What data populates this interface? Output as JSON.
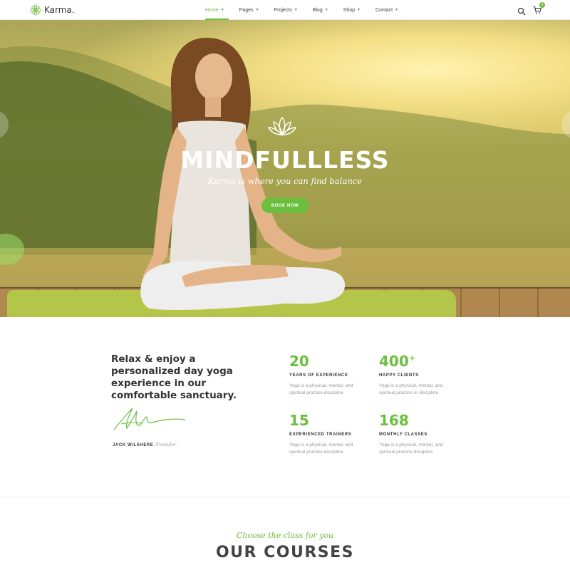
{
  "header": {
    "logo_text": "Karma.",
    "logo_icon": "flower-icon",
    "nav": [
      {
        "label": "Home",
        "active": true
      },
      {
        "label": "Pages",
        "active": false
      },
      {
        "label": "Projects",
        "active": false
      },
      {
        "label": "Blog",
        "active": false
      },
      {
        "label": "Shop",
        "active": false
      },
      {
        "label": "Contact",
        "active": false
      }
    ],
    "cart_count": "0",
    "accent_color": "#6bbf3c"
  },
  "hero": {
    "title": "MINDFULLLESS",
    "subtitle": "Karma is where you can find balance",
    "button": "BOOK NOW"
  },
  "intro": {
    "heading": "Relax & enjoy a personalized day yoga experience in our comfortable sanctuary.",
    "founder_name": "JACK WILSHERE",
    "founder_role": "/Founder"
  },
  "stats": [
    {
      "number": "20",
      "plus": "",
      "label": "YEARS OF EXPERIENCE",
      "desc": "Yoga is a physical, mental, and spiritual practice discipline"
    },
    {
      "number": "400",
      "plus": "+",
      "label": "HAPPY CLIENTS",
      "desc": "Yoga is a physical, mental, and spiritual practice or discipline"
    },
    {
      "number": "15",
      "plus": "",
      "label": "EXPERIENCED TRAINERS",
      "desc": "Yoga is a physical, mental, and spiritual practice discipline"
    },
    {
      "number": "168",
      "plus": "",
      "label": "MONTHLY CLASSES",
      "desc": "Yoga is a physical, mental, and spiritual practice discipline"
    }
  ],
  "courses": {
    "script": "Choose the class for you",
    "title": "OUR COURSES"
  }
}
